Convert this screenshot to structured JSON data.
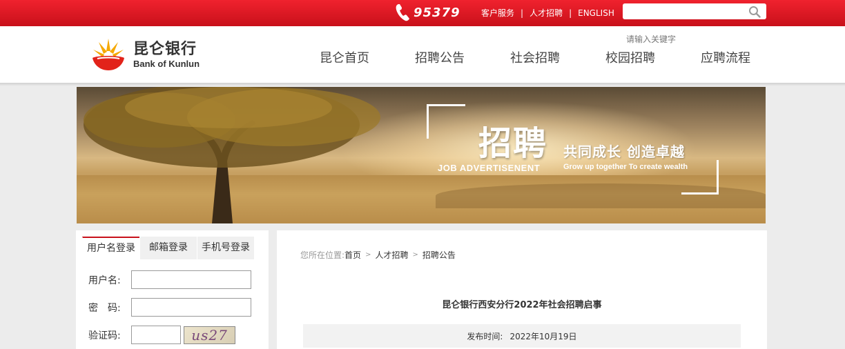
{
  "topbar": {
    "hotline": "95379",
    "links": [
      "客户服务",
      "人才招聘",
      "ENGLISH"
    ],
    "separator": "|",
    "search_placeholder": ""
  },
  "header": {
    "logo_cn": "昆仑银行",
    "logo_en": "Bank of Kunlun",
    "search_hint": "请输入关键字",
    "nav": [
      "昆仑首页",
      "招聘公告",
      "社会招聘",
      "校园招聘",
      "应聘流程"
    ]
  },
  "banner": {
    "title": "招聘",
    "subtitle": "共同成长  创造卓越",
    "en_title": "JOB  ADVERTISENENT",
    "en_subtitle": "Grow up together To create wealth"
  },
  "login": {
    "tabs": [
      "用户名登录",
      "邮箱登录",
      "手机号登录"
    ],
    "active_tab": 0,
    "username_label": "用户名:",
    "password_label": "密　码:",
    "captcha_label": "验证码:",
    "username_value": "",
    "password_value": "",
    "captcha_value": "",
    "captcha_text": "us27"
  },
  "content": {
    "breadcrumb_prefix": "您所在位置:",
    "breadcrumb": [
      "首页",
      "人才招聘",
      "招聘公告"
    ],
    "breadcrumb_sep": ">",
    "article_title": "昆仑银行西安分行2022年社会招聘启事",
    "pub_label": "发布时间:",
    "pub_date": "2022年10月19日"
  },
  "colors": {
    "brand_red": "#c8101a",
    "logo_yellow": "#f5a800",
    "logo_red": "#e2231a"
  }
}
